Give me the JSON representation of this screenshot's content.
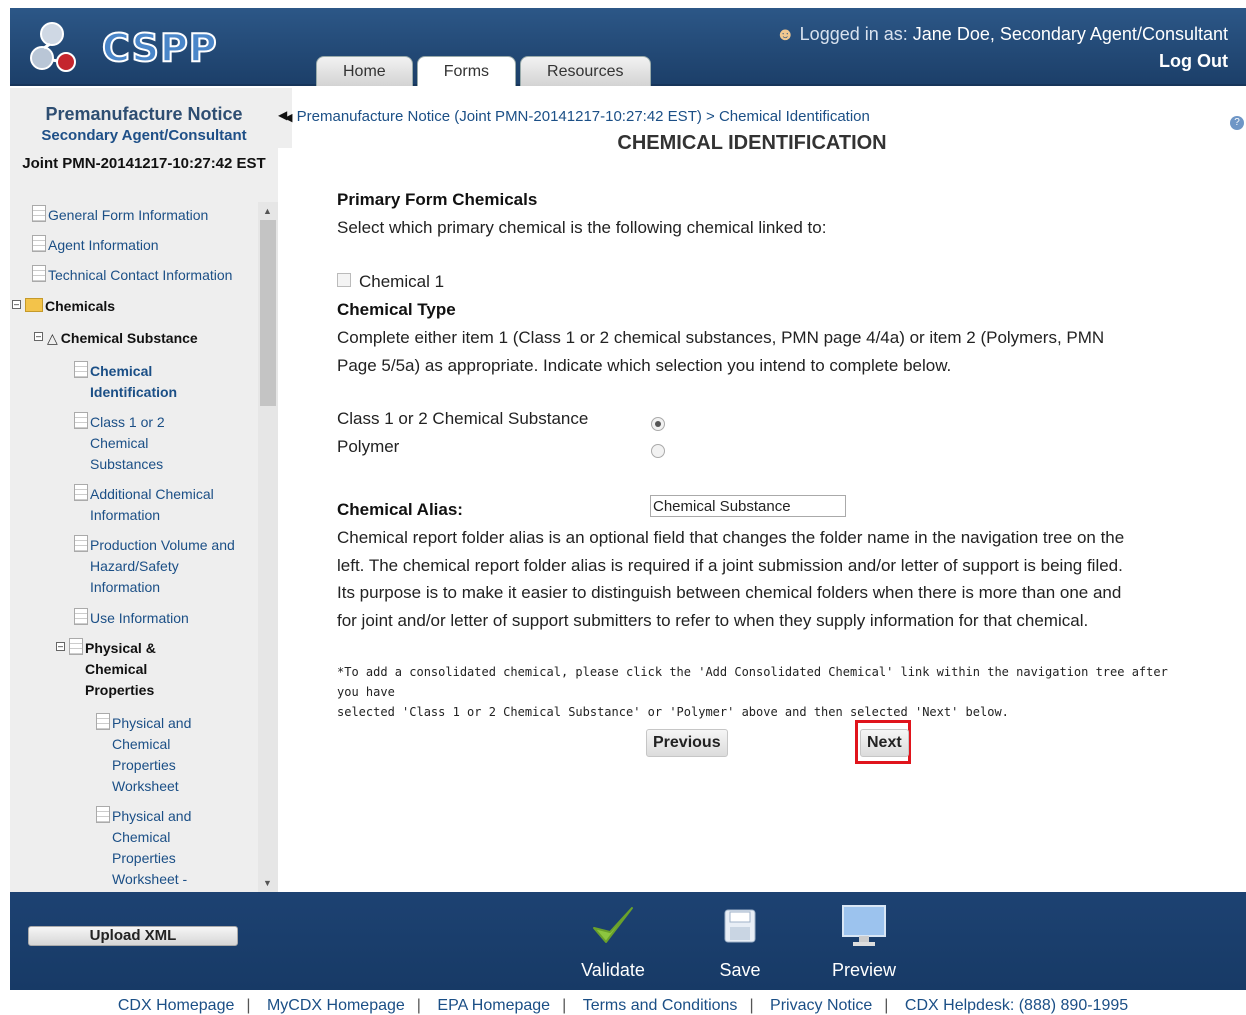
{
  "header": {
    "logo_text": "CSPP",
    "logged_in_prefix": "Logged in as:",
    "user": "Jane Doe, Secondary Agent/Consultant",
    "logout": "Log Out",
    "tabs": [
      "Home",
      "Forms",
      "Resources"
    ],
    "active_tab": "Forms"
  },
  "sidebar": {
    "title": "Premanufacture Notice",
    "subtitle": "Secondary Agent/Consultant",
    "submission_id": "Joint PMN-20141217-10:27:42 EST",
    "tree": [
      {
        "label": "General Form Information",
        "icon": "document-icon"
      },
      {
        "label": "Agent Information",
        "icon": "document-icon"
      },
      {
        "label": "Technical Contact Information",
        "icon": "document-icon"
      },
      {
        "label": "Chemicals",
        "icon": "folder-icon"
      },
      {
        "label": "Chemical Substance",
        "icon": "flask-icon"
      },
      {
        "label": "Chemical Identification",
        "icon": "document-icon"
      },
      {
        "label": "Class 1 or 2 Chemical Substances",
        "icon": "document-icon"
      },
      {
        "label": "Additional Chemical Information",
        "icon": "document-icon"
      },
      {
        "label": "Production Volume and Hazard/Safety Information",
        "icon": "document-icon"
      },
      {
        "label": "Use Information",
        "icon": "document-icon"
      },
      {
        "label": "Physical & Chemical Properties",
        "icon": "edit-document-icon"
      },
      {
        "label": "Physical and Chemical Properties Worksheet",
        "icon": "document-icon"
      },
      {
        "label": "Physical and Chemical Properties Worksheet -",
        "icon": "document-icon"
      }
    ]
  },
  "main": {
    "breadcrumb": "Premanufacture Notice (Joint PMN-20141217-10:27:42 EST) > Chemical Identification",
    "title": "CHEMICAL IDENTIFICATION",
    "primary_heading": "Primary Form Chemicals",
    "primary_text": "Select which primary chemical is the following chemical linked to:",
    "chemical_checkbox_label": "Chemical 1",
    "chemical_checkbox_checked": false,
    "type_heading": "Chemical Type",
    "type_text_line1": "Complete either item 1 (Class 1 or 2 chemical substances, PMN page 4/4a) or item 2 (Polymers, PMN",
    "type_text_line2": "Page 5/5a) as appropriate. Indicate which selection you intend to complete below.",
    "option_class": "Class 1 or 2 Chemical Substance",
    "option_polymer": "Polymer",
    "selected_option": "Class 1 or 2 Chemical Substance",
    "alias_heading": "Chemical Alias:",
    "alias_value": "Chemical Substance",
    "alias_text_lines": [
      "Chemical report folder alias is an optional field that changes the folder name in the navigation tree on the",
      "left. The chemical report folder alias is required if a joint submission and/or letter of support is being filed.",
      "Its purpose is to make it easier to distinguish between chemical folders when there is more than one and",
      "for joint and/or letter of support submitters to refer to when they supply information for that chemical."
    ],
    "note_line1": "*To add a consolidated chemical, please click the 'Add Consolidated Chemical' link within the navigation tree after you have",
    "note_line2": "selected 'Class 1 or 2 Chemical Substance' or 'Polymer' above and then selected 'Next' below.",
    "previous_label": "Previous",
    "next_label": "Next"
  },
  "actionbar": {
    "upload_label": "Upload XML",
    "validate_label": "Validate",
    "save_label": "Save",
    "preview_label": "Preview"
  },
  "footer_links": [
    "CDX Homepage",
    "MyCDX Homepage",
    "EPA Homepage",
    "Terms and Conditions",
    "Privacy Notice",
    "CDX Helpdesk: (888) 890-1995"
  ],
  "colors": {
    "header_blue": "#1c3f69",
    "link_blue": "#1b4f86",
    "highlight_red": "#e0141c",
    "validate_green": "#8cc63f"
  }
}
